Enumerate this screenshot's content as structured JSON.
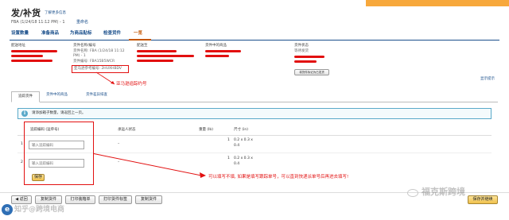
{
  "header": {
    "title": "发/补货",
    "help_link": "了解更多信息",
    "subtitle": "FBA (1/24/18 11:12 PM) - 1",
    "rename_link": "重命名"
  },
  "nav": {
    "steps": [
      "设置数量",
      "准备商品",
      "为商品贴标",
      "检查货件",
      "一览"
    ],
    "active_index": 4
  },
  "shipment_info": {
    "ship_from_label": "配送地址",
    "name_label": "货件名称/编号",
    "name_value_line1": "货件名称: FBA (1/24/18 11:12",
    "name_value_line2": "PM) - 1",
    "id_value": "货件编号: FBA15B5WCR",
    "reference_label": "亚马逊参考编号: 2HUXHBDV",
    "ship_to_label": "配送至",
    "contents_label": "货件中的商品",
    "status_label": "货件状态",
    "status_value": "等待发货",
    "status_button": "将货件标记为已发货",
    "tips_link": "显示提示"
  },
  "annotations": {
    "amazon_ref": "亚马逊追踪约号",
    "tracking_note": "可以填写不填, 如果是填写跟踪单号，可以直到快递派单号后再进去填写!"
  },
  "tabs": [
    "追踪货件",
    "货件中的商品",
    "货件差异排查"
  ],
  "info_message": "请添加箱子数量，请返回上一页。",
  "table": {
    "col_tracking": "追踪编码 (运单号)",
    "col_carrier": "承运人状态",
    "col_weight": "重量 (lb)",
    "col_dims": "尺寸 (in)",
    "rows": [
      {
        "index": "1",
        "placeholder": "输入追踪编码",
        "carrier": "–",
        "weight": "1",
        "dims_line1": "0.2 x 0.3 x",
        "dims_line2": "0.4"
      },
      {
        "index": "2",
        "placeholder": "输入追踪编码",
        "carrier": "–",
        "weight": "1",
        "dims_line1": "0.2 x 0.3 x",
        "dims_line2": "0.4"
      }
    ],
    "save_button": "保存"
  },
  "footer": {
    "buttons": [
      "返回",
      "复制货件",
      "打印装箱单",
      "打印货件标签",
      "复制货件"
    ],
    "watermark": "知乎@跨境电商",
    "logo_text": "福克斯跨境",
    "right_button": "保存并继续"
  },
  "colors": {
    "accent": "#1a4f8b",
    "nav_active": "#c45500",
    "annotation_red": "#e21010",
    "top_bar_orange": "#f7a83c",
    "info_blue": "#5aa9c9"
  }
}
